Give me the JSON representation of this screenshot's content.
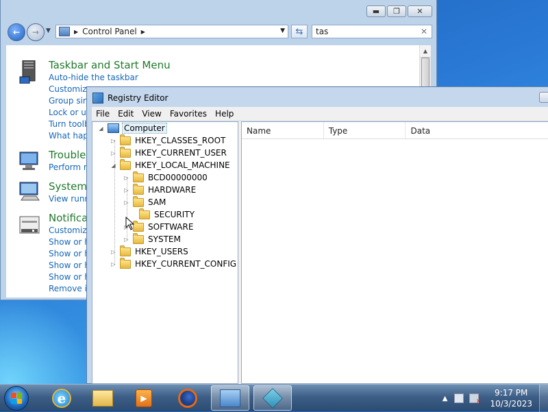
{
  "control_panel": {
    "address": {
      "location": "Control Panel"
    },
    "search": {
      "value": "tas"
    },
    "sections": [
      {
        "icon": "taskbar-icon",
        "title": "Taskbar and Start Menu",
        "links": [
          "Auto-hide the taskbar",
          "Customize",
          "Group sim",
          "Lock or un",
          "Turn toolb",
          "What happ"
        ]
      },
      {
        "icon": "troubleshoot-icon",
        "title": "Troubles",
        "links": [
          "Perform re"
        ]
      },
      {
        "icon": "system-icon",
        "title": "System",
        "links": [
          "View runni"
        ]
      },
      {
        "icon": "notification-icon",
        "title": "Notificat",
        "links": [
          "Customize",
          "Show or hi",
          "Show or hi",
          "Show or hi",
          "Show or hi",
          "Remove ic"
        ]
      }
    ]
  },
  "registry_editor": {
    "title": "Registry Editor",
    "menu": [
      "File",
      "Edit",
      "View",
      "Favorites",
      "Help"
    ],
    "tree": {
      "root": "Computer",
      "hives": [
        "HKEY_CLASSES_ROOT",
        "HKEY_CURRENT_USER",
        "HKEY_LOCAL_MACHINE"
      ],
      "hklm_children": [
        "BCD00000000",
        "HARDWARE",
        "SAM",
        "SECURITY",
        "SOFTWARE",
        "SYSTEM"
      ],
      "hives_after": [
        "HKEY_USERS",
        "HKEY_CURRENT_CONFIG"
      ]
    },
    "columns": [
      "Name",
      "Type",
      "Data"
    ]
  },
  "taskbar": {
    "pinned": [
      {
        "name": "internet-explorer",
        "icon": "internet-explorer-icon"
      },
      {
        "name": "windows-explorer",
        "icon": "folder-icon"
      },
      {
        "name": "windows-media-player",
        "icon": "media-player-icon"
      },
      {
        "name": "firefox",
        "icon": "firefox-icon"
      },
      {
        "name": "control-panel",
        "icon": "control-panel-icon"
      },
      {
        "name": "registry-editor",
        "icon": "registry-editor-icon"
      }
    ],
    "clock": {
      "time": "9:17 PM",
      "date": "10/3/2023"
    }
  },
  "colors": {
    "link": "#1466b8",
    "section_title": "#1e7a2a",
    "taskbar": "#3d5e86"
  }
}
